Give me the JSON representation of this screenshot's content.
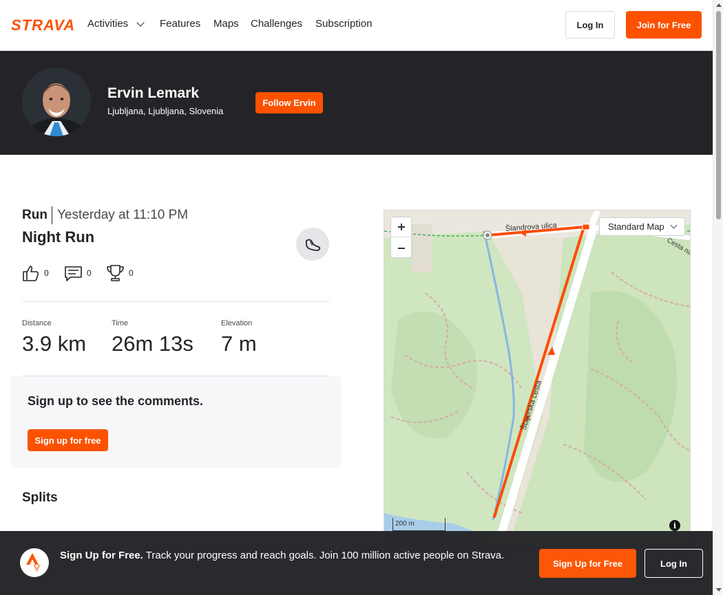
{
  "nav": {
    "logo_text": "STRAVA",
    "brand_color": "#fc5200",
    "items": [
      {
        "label": "Activities",
        "has_dropdown": true
      },
      {
        "label": "Features"
      },
      {
        "label": "Maps"
      },
      {
        "label": "Challenges"
      },
      {
        "label": "Subscription"
      }
    ],
    "login_label": "Log In",
    "join_label": "Join for Free"
  },
  "athlete": {
    "name": "Ervin Lemark",
    "location": "Ljubljana, Ljubljana, Slovenia",
    "follow_label": "Follow Ervin"
  },
  "activity": {
    "type": "Run",
    "date": "Yesterday at 11:10 PM",
    "title": "Night Run",
    "kudos_count": "0",
    "comments_count": "0",
    "achievements_count": "0",
    "stats": [
      {
        "label": "Distance",
        "value": "3.9 km"
      },
      {
        "label": "Time",
        "value": "26m 13s"
      },
      {
        "label": "Elevation",
        "value": "7 m"
      }
    ]
  },
  "comments": {
    "title": "Sign up to see the comments.",
    "button_label": "Sign up for free"
  },
  "splits": {
    "title": "Splits"
  },
  "map": {
    "style_select": "Standard Map",
    "scale_label": "200 m",
    "street_labels": [
      "Šlandrova ulica",
      "Štajerska cesta",
      "Cesta na"
    ],
    "route_color": "#fc4c02"
  },
  "banner": {
    "headline": "Sign Up for Free.",
    "body": "Track your progress and reach goals. Join 100 million active people on Strava.",
    "signup_label": "Sign Up for Free",
    "login_label": "Log In"
  }
}
